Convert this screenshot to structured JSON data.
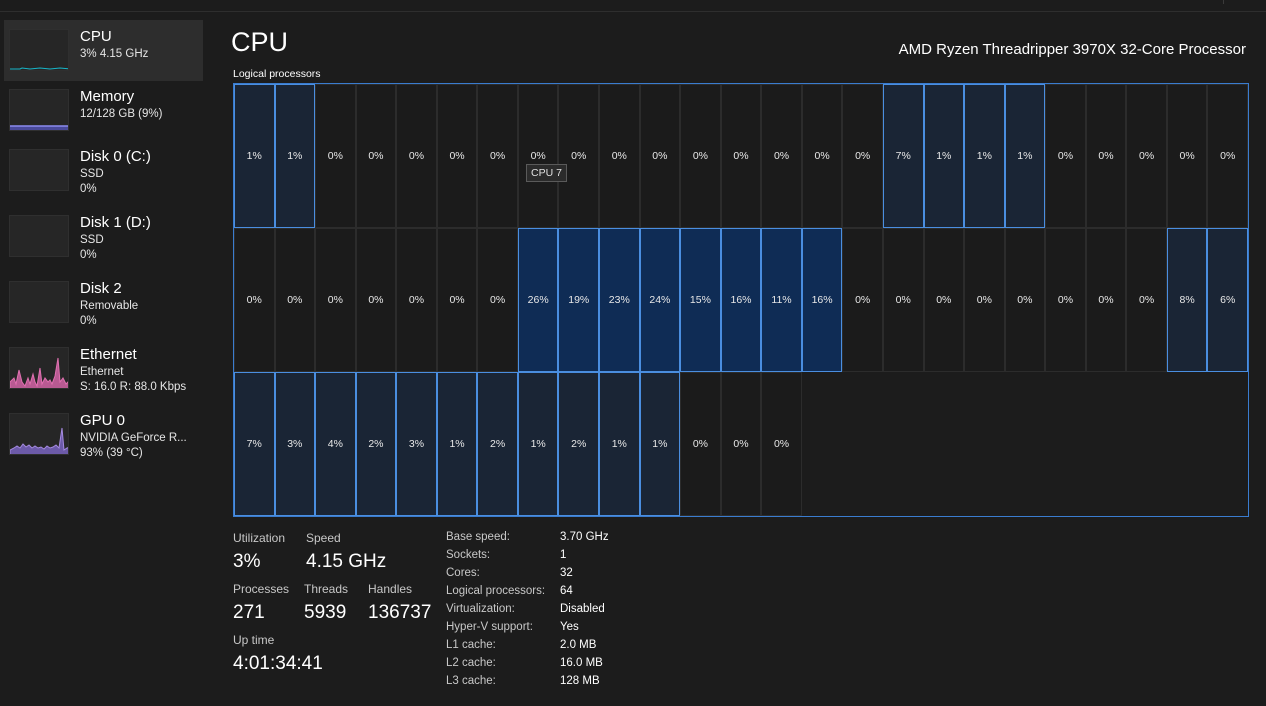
{
  "sidebar": {
    "items": [
      {
        "title": "CPU",
        "lines": [
          "3%  4.15 GHz"
        ],
        "selected": true,
        "graph_color": "#17b6c9"
      },
      {
        "title": "Memory",
        "lines": [
          "12/128 GB (9%)"
        ],
        "selected": false,
        "graph_color": "#8b8bf0"
      },
      {
        "title": "Disk 0 (C:)",
        "lines": [
          "SSD",
          "0%"
        ],
        "selected": false,
        "graph_color": "#4fb06a"
      },
      {
        "title": "Disk 1 (D:)",
        "lines": [
          "SSD",
          "0%"
        ],
        "selected": false,
        "graph_color": "#4fb06a"
      },
      {
        "title": "Disk 2",
        "lines": [
          "Removable",
          "0%"
        ],
        "selected": false,
        "graph_color": "#4fb06a"
      },
      {
        "title": "Ethernet",
        "lines": [
          "Ethernet",
          "S: 16.0  R: 88.0 Kbps"
        ],
        "selected": false,
        "graph_color": "#e070b0"
      },
      {
        "title": "GPU 0",
        "lines": [
          "NVIDIA GeForce R...",
          "93%  (39 °C)"
        ],
        "selected": false,
        "graph_color": "#8a6fc9"
      }
    ]
  },
  "main": {
    "title": "CPU",
    "processor_name": "AMD Ryzen Threadripper 3970X 32-Core Processor",
    "grid_label": "Logical processors",
    "tooltip": "CPU 7"
  },
  "logical_processors": [
    "1%",
    "1%",
    "0%",
    "0%",
    "0%",
    "0%",
    "0%",
    "0%",
    "0%",
    "0%",
    "0%",
    "0%",
    "0%",
    "0%",
    "0%",
    "0%",
    "7%",
    "1%",
    "1%",
    "1%",
    "0%",
    "0%",
    "0%",
    "0%",
    "0%",
    "0%",
    "0%",
    "0%",
    "0%",
    "0%",
    "0%",
    "0%",
    "26%",
    "19%",
    "23%",
    "24%",
    "15%",
    "16%",
    "11%",
    "16%",
    "0%",
    "0%",
    "0%",
    "0%",
    "0%",
    "0%",
    "0%",
    "0%",
    "8%",
    "6%",
    "7%",
    "3%",
    "4%",
    "2%",
    "3%",
    "1%",
    "2%",
    "1%",
    "2%",
    "1%",
    "1%",
    "0%",
    "0%",
    "0%"
  ],
  "stats": {
    "utilization": {
      "label": "Utilization",
      "value": "3%"
    },
    "speed": {
      "label": "Speed",
      "value": "4.15 GHz"
    },
    "processes": {
      "label": "Processes",
      "value": "271"
    },
    "threads": {
      "label": "Threads",
      "value": "5939"
    },
    "handles": {
      "label": "Handles",
      "value": "136737"
    },
    "uptime": {
      "label": "Up time",
      "value": "4:01:34:41"
    }
  },
  "specs": [
    {
      "label": "Base speed:",
      "value": "3.70 GHz"
    },
    {
      "label": "Sockets:",
      "value": "1"
    },
    {
      "label": "Cores:",
      "value": "32"
    },
    {
      "label": "Logical processors:",
      "value": "64"
    },
    {
      "label": "Virtualization:",
      "value": "Disabled"
    },
    {
      "label": "Hyper-V support:",
      "value": "Yes"
    },
    {
      "label": "L1 cache:",
      "value": "2.0 MB"
    },
    {
      "label": "L2 cache:",
      "value": "16.0 MB"
    },
    {
      "label": "L3 cache:",
      "value": "128 MB"
    }
  ],
  "colors": {
    "background": "#1c1c1c",
    "grid_border": "#3a7ccf",
    "cell_active_border": "#4a8ee0",
    "cell_fill_low": "#1a2535",
    "cell_fill_high": "#0f2c55"
  }
}
